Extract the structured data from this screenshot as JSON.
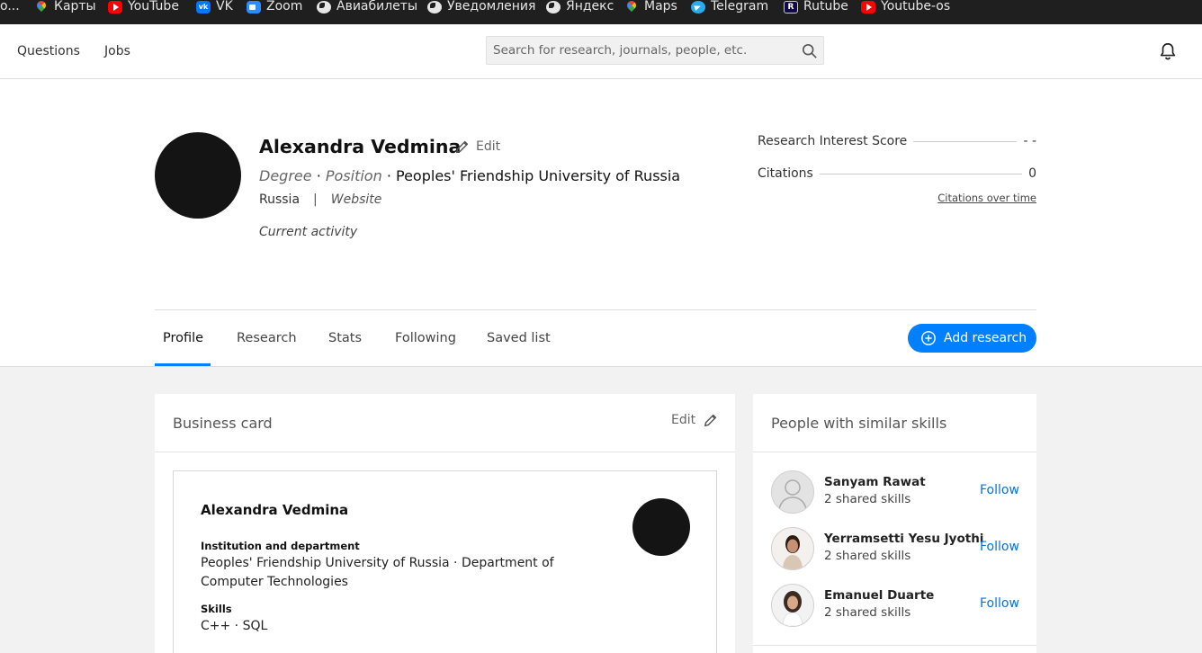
{
  "bookmarks": [
    {
      "label": "o...",
      "icon": "truncated"
    },
    {
      "label": "Карты",
      "icon": "maps-icon"
    },
    {
      "label": "YouTube",
      "icon": "youtube-icon"
    },
    {
      "label": "VK",
      "icon": "vk-icon"
    },
    {
      "label": "Zoom",
      "icon": "zoom-icon"
    },
    {
      "label": "Авиабилеты",
      "icon": "globe-icon"
    },
    {
      "label": "Уведомления",
      "icon": "globe-icon"
    },
    {
      "label": "Яндекс",
      "icon": "globe-icon"
    },
    {
      "label": "Maps",
      "icon": "maps-icon"
    },
    {
      "label": "Telegram",
      "icon": "telegram-icon"
    },
    {
      "label": "Rutube",
      "icon": "rutube-icon"
    },
    {
      "label": "Youtube-os",
      "icon": "youtube-icon"
    }
  ],
  "nav": {
    "questions": "Questions",
    "jobs": "Jobs",
    "search_placeholder": "Search for research, journals, people, etc."
  },
  "profile": {
    "name": "Alexandra Vedmina",
    "edit": "Edit",
    "degree": "Degree",
    "position": "Position",
    "institution": "Peoples' Friendship University of Russia",
    "country": "Russia",
    "website": "Website",
    "activity": "Current activity"
  },
  "stats": {
    "ris_label": "Research Interest Score",
    "ris_value": "- -",
    "citations_label": "Citations",
    "citations_value": "0",
    "citations_link": "Citations over time"
  },
  "tabs": [
    "Profile",
    "Research",
    "Stats",
    "Following",
    "Saved list"
  ],
  "add_research": "Add research",
  "business_card": {
    "title": "Business card",
    "edit": "Edit",
    "name": "Alexandra Vedmina",
    "inst_label": "Institution and department",
    "inst_value": "Peoples' Friendship University of Russia · Department of Computer Technologies",
    "skills_label": "Skills",
    "skills_value": "C++ · SQL"
  },
  "similar": {
    "title": "People with similar skills",
    "people": [
      {
        "name": "Sanyam Rawat",
        "sub": "2 shared skills",
        "follow": "Follow"
      },
      {
        "name": "Yerramsetti Yesu Jyothi",
        "sub": "2 shared skills",
        "follow": "Follow"
      },
      {
        "name": "Emanuel Duarte",
        "sub": "2 shared skills",
        "follow": "Follow"
      }
    ]
  },
  "colors": {
    "accent": "#0080ff",
    "link": "#0075e0",
    "bookmark_bar": "#1f1f1f"
  }
}
